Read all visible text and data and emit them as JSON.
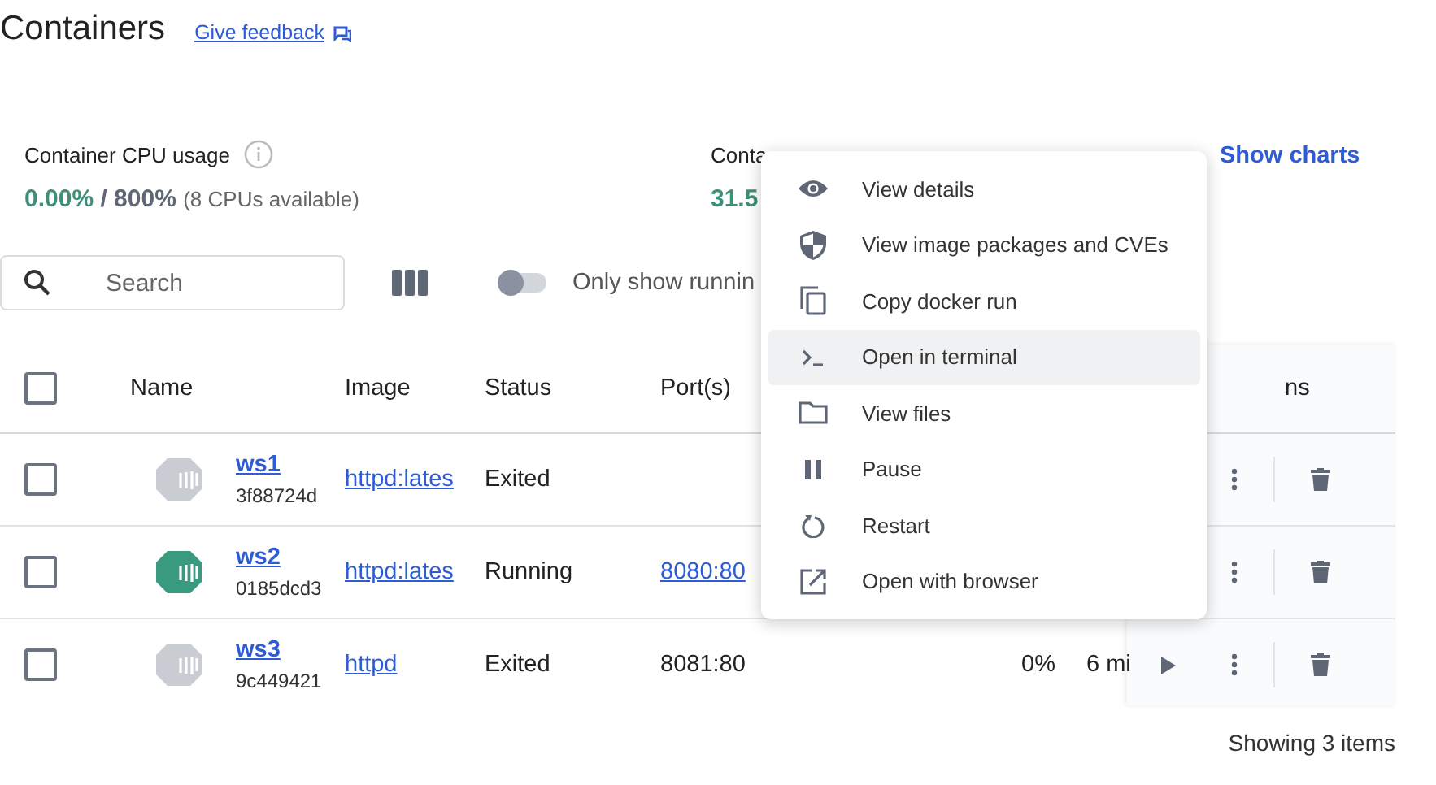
{
  "header": {
    "title": "Containers",
    "feedback_link": "Give feedback"
  },
  "stats": [
    {
      "label": "Container CPU usage",
      "value": "0.00%",
      "total": "/ 800%",
      "note": "(8 CPUs available)"
    },
    {
      "label": "Conta",
      "value": "31.5"
    }
  ],
  "show_charts": "Show charts",
  "toolbar": {
    "search": {
      "placeholder": "Search"
    },
    "toggle": {
      "label": "Only show runnin",
      "on": false
    }
  },
  "table": {
    "all_selected": false,
    "columns": [
      "Name",
      "Image",
      "Status",
      "Port(s)",
      "ns"
    ],
    "rows": [
      {
        "name": "ws1",
        "id": "3f88724d",
        "image": "httpd:lates",
        "status": "Exited",
        "running": false,
        "selected": false
      },
      {
        "name": "ws2",
        "id": "0185dcd3",
        "image": "httpd:lates",
        "status": "Running",
        "running": true,
        "ports": "8080:80",
        "selected": false
      },
      {
        "name": "ws3",
        "id": "9c449421",
        "image": "httpd",
        "status": "Exited",
        "running": false,
        "ports_text": "8081:80",
        "cpu": "0%",
        "started": "6 mi",
        "start_button": true,
        "selected": false
      }
    ]
  },
  "footer": "Showing 3 items",
  "menu": [
    {
      "label": "View details",
      "selected": false
    },
    {
      "label": "View image packages and CVEs",
      "selected": false
    },
    {
      "label": "Copy docker run",
      "selected": false
    },
    {
      "label": "Open in terminal",
      "selected": true
    },
    {
      "label": "View files",
      "selected": false
    },
    {
      "label": "Pause",
      "selected": false
    },
    {
      "label": "Restart",
      "selected": false
    },
    {
      "label": "Open with browser",
      "selected": false
    }
  ]
}
